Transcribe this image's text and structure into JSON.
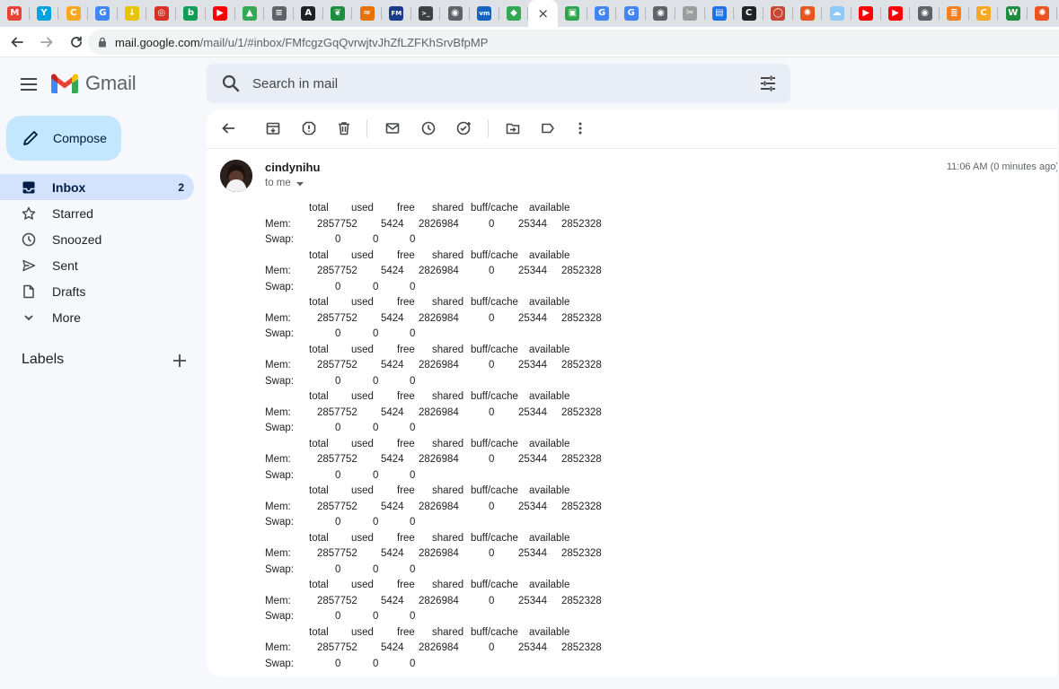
{
  "browser": {
    "tabs": [
      {
        "icon": "gmail-icon",
        "color": "#ea4335",
        "glyph": "M"
      },
      {
        "icon": "y-icon",
        "color": "#00a1e0",
        "glyph": "Y"
      },
      {
        "icon": "c-icon",
        "color": "#f9a825",
        "glyph": "C"
      },
      {
        "icon": "google-icon",
        "color": "#4285f4",
        "glyph": "G"
      },
      {
        "icon": "download-icon",
        "color": "#e6c400",
        "glyph": "↓"
      },
      {
        "icon": "red-cloud-icon",
        "color": "#d93025",
        "glyph": "◎"
      },
      {
        "icon": "green-bird-icon",
        "color": "#0f9d58",
        "glyph": "b"
      },
      {
        "icon": "youtube-icon",
        "color": "#ff0000",
        "glyph": "▶"
      },
      {
        "icon": "drive-icon",
        "color": "#34a853",
        "glyph": "▲"
      },
      {
        "icon": "doc-icon",
        "color": "#5f6368",
        "glyph": "≡"
      },
      {
        "icon": "a-icon",
        "color": "#202124",
        "glyph": "A"
      },
      {
        "icon": "feather-icon",
        "color": "#1e8e3e",
        "glyph": "❦"
      },
      {
        "icon": "chart-icon",
        "color": "#e8710a",
        "glyph": "≈"
      },
      {
        "icon": "fm-icon",
        "color": "#1a3a8a",
        "glyph": "FM"
      },
      {
        "icon": "terminal-icon",
        "color": "#3c4043",
        "glyph": ">_"
      },
      {
        "icon": "chrome-icon",
        "color": "#5f6368",
        "glyph": "◉"
      },
      {
        "icon": "vmware-icon",
        "color": "#1565c0",
        "glyph": "vm"
      },
      {
        "icon": "maps-icon",
        "color": "#34a853",
        "glyph": "◆"
      },
      {
        "icon": "close-icon",
        "color": "#3c4043",
        "glyph": "×",
        "active": true
      },
      {
        "icon": "gitlab-icon",
        "color": "#2ea44f",
        "glyph": "▣"
      },
      {
        "icon": "google-icon",
        "color": "#4285f4",
        "glyph": "G"
      },
      {
        "icon": "google-icon",
        "color": "#4285f4",
        "glyph": "G"
      },
      {
        "icon": "chrome-icon",
        "color": "#5f6368",
        "glyph": "◉"
      },
      {
        "icon": "tools-icon",
        "color": "#9e9e9e",
        "glyph": "✂"
      },
      {
        "icon": "doc-blue-icon",
        "color": "#1a73e8",
        "glyph": "▤"
      },
      {
        "icon": "c-black-icon",
        "color": "#202124",
        "glyph": "C"
      },
      {
        "icon": "oracle-icon",
        "color": "#c74634",
        "glyph": "◯"
      },
      {
        "icon": "ubuntu-icon",
        "color": "#e95420",
        "glyph": "✺"
      },
      {
        "icon": "cloud-icon",
        "color": "#90caf9",
        "glyph": "☁"
      },
      {
        "icon": "youtube-icon",
        "color": "#ff0000",
        "glyph": "▶"
      },
      {
        "icon": "youtube-icon",
        "color": "#ff0000",
        "glyph": "▶"
      },
      {
        "icon": "chrome-icon",
        "color": "#5f6368",
        "glyph": "◉"
      },
      {
        "icon": "stackoverflow-icon",
        "color": "#f48024",
        "glyph": "≣"
      },
      {
        "icon": "c-icon",
        "color": "#f9a825",
        "glyph": "C"
      },
      {
        "icon": "w-icon",
        "color": "#1e8e3e",
        "glyph": "W"
      },
      {
        "icon": "ubuntu-icon",
        "color": "#e95420",
        "glyph": "✺"
      }
    ],
    "url_host": "mail.google.com",
    "url_path": "/mail/u/1/#inbox/FMfcgzGqQvrwjtvJhZfLZFKhSrvBfpMP"
  },
  "gmail": {
    "wordmark": "Gmail",
    "search_placeholder": "Search in mail",
    "compose_label": "Compose",
    "nav": [
      {
        "label": "Inbox",
        "icon": "inbox-icon",
        "count": "2",
        "active": true
      },
      {
        "label": "Starred",
        "icon": "star-icon",
        "count": ""
      },
      {
        "label": "Snoozed",
        "icon": "clock-icon",
        "count": ""
      },
      {
        "label": "Sent",
        "icon": "send-icon",
        "count": ""
      },
      {
        "label": "Drafts",
        "icon": "draft-icon",
        "count": ""
      },
      {
        "label": "More",
        "icon": "chevron-down-icon",
        "count": ""
      }
    ],
    "labels_header": "Labels",
    "message": {
      "sender": "cindynihu",
      "to": "to me",
      "time": "11:06 AM (0 minutes ago)",
      "header_row": [
        "total",
        "used",
        "free",
        "shared",
        "buff/cache",
        "available"
      ],
      "mem_row": [
        "Mem:",
        "2857752",
        "5424",
        "2826984",
        "0",
        "25344",
        "2852328"
      ],
      "swap_row": [
        "Swap:",
        "0",
        "0",
        "0"
      ],
      "repeat_count": 10
    }
  },
  "colors": {
    "accent": "#c2e7ff",
    "active_nav": "#d3e3fd",
    "background": "#f6f8fc"
  }
}
